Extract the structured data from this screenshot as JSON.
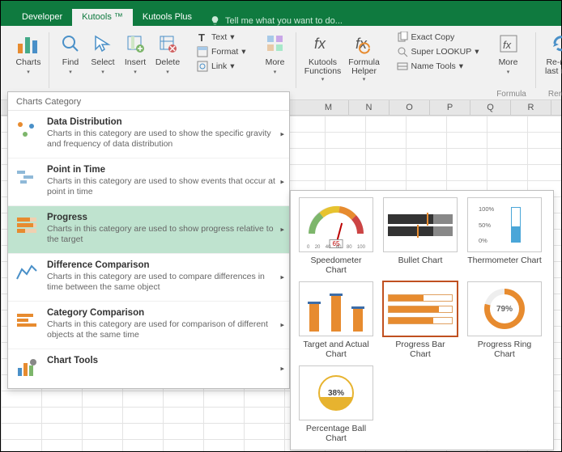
{
  "tabs": {
    "developer": "Developer",
    "kutools": "Kutools ™",
    "kutools_plus": "Kutools Plus"
  },
  "tell_me": "Tell me what you want to do...",
  "ribbon": {
    "charts": "Charts",
    "find": "Find",
    "select": "Select",
    "insert": "Insert",
    "delete": "Delete",
    "text": "Text",
    "format": "Format",
    "link": "Link",
    "more": "More",
    "kutools_functions": "Kutools\nFunctions",
    "formula_helper": "Formula\nHelper",
    "exact_copy": "Exact Copy",
    "super_lookup": "Super LOOKUP",
    "name_tools": "Name Tools",
    "more2": "More",
    "rerun": "Re-run\nlast utili",
    "group_formula": "Formula",
    "group_rerun": "Rerun"
  },
  "columns": [
    "",
    "",
    "",
    "",
    "",
    "",
    "",
    "",
    "M",
    "N",
    "O",
    "P",
    "Q",
    "R"
  ],
  "panel_title": "Charts Category",
  "cats": [
    {
      "name": "Data Distribution",
      "desc": "Charts in this category are used to show the specific gravity and frequency of data distribution"
    },
    {
      "name": "Point in Time",
      "desc": "Charts in this category are used to show events that occur at point in time"
    },
    {
      "name": "Progress",
      "desc": "Charts in this category are used to show progress relative to the target"
    },
    {
      "name": "Difference Comparison",
      "desc": "Charts in this category are used to compare differences in time between the same object"
    },
    {
      "name": "Category Comparison",
      "desc": "Charts in this category are used for comparison of different objects at the same time"
    },
    {
      "name": "Chart Tools",
      "desc": ""
    }
  ],
  "charts": {
    "speedometer": {
      "label": "Speedometer\nChart",
      "value": "65",
      "ticks": [
        "0",
        "20",
        "40",
        "60",
        "80",
        "100"
      ]
    },
    "bullet": {
      "label": "Bullet Chart"
    },
    "thermometer": {
      "label": "Thermometer Chart",
      "ticks": [
        "100%",
        "50%",
        "0%"
      ]
    },
    "target_actual": {
      "label": "Target and Actual\nChart"
    },
    "progress_bar": {
      "label": "Progress Bar\nChart"
    },
    "progress_ring": {
      "label": "Progress Ring\nChart",
      "value": "79%"
    },
    "percentage_ball": {
      "label": "Percentage Ball\nChart",
      "value": "38%"
    }
  }
}
